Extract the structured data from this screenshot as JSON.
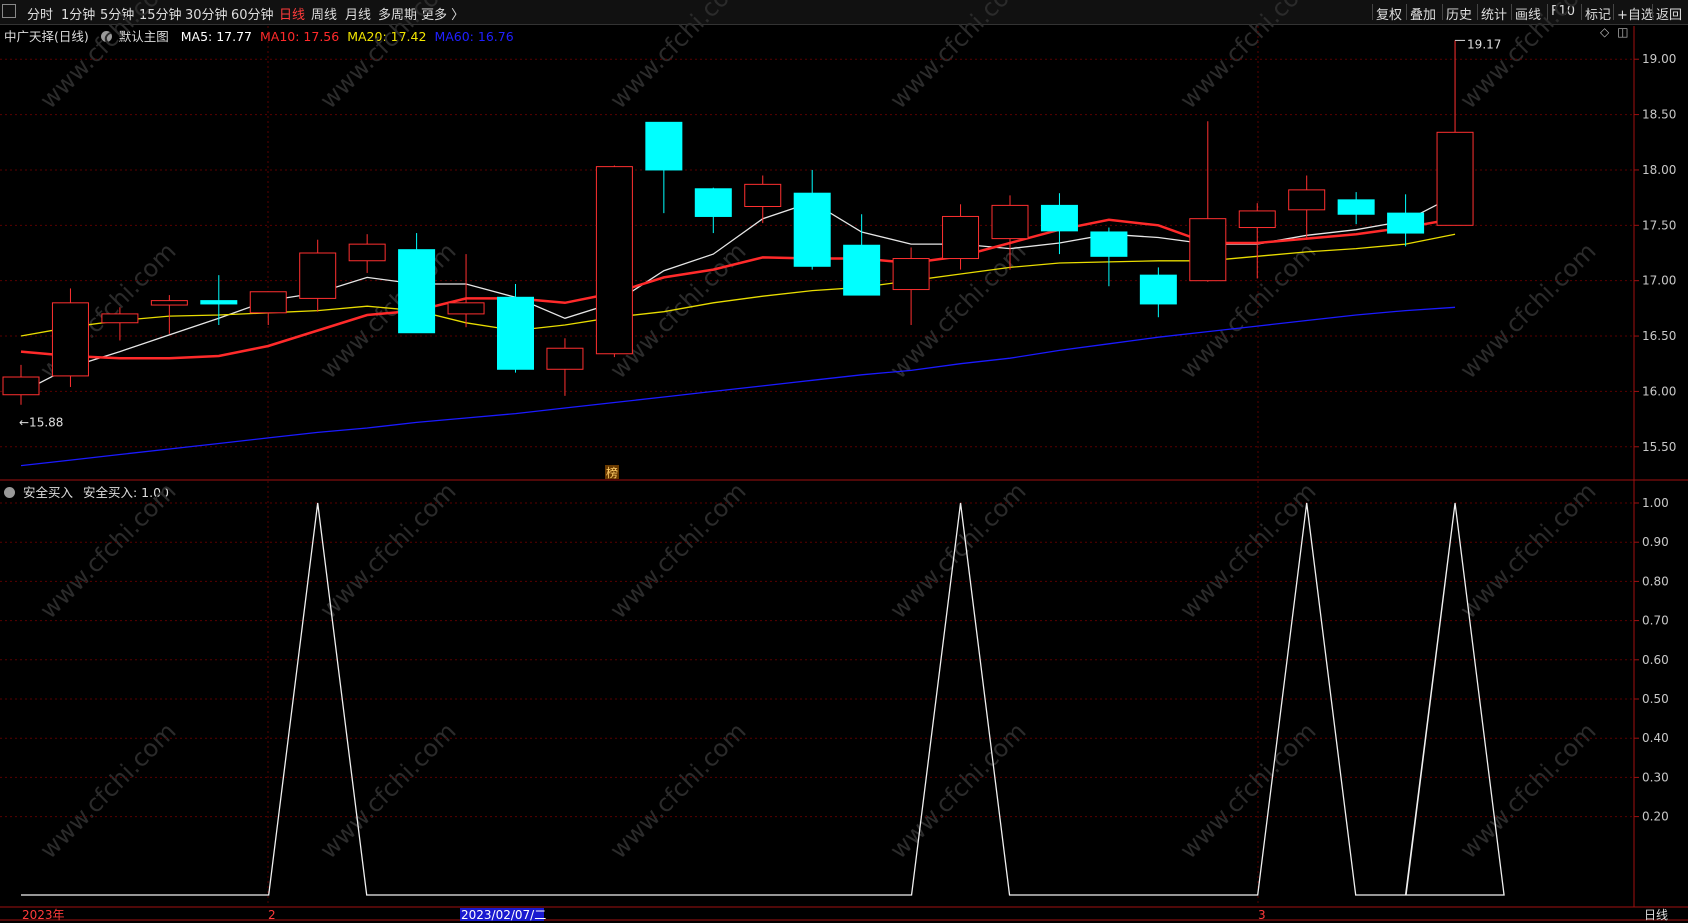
{
  "toolbar": {
    "periods": [
      "分时",
      "1分钟",
      "5分钟",
      "15分钟",
      "30分钟",
      "60分钟",
      "日线",
      "周线",
      "月线",
      "多周期",
      "更多 〉"
    ],
    "active_period": "日线",
    "tools": [
      "复权",
      "叠加",
      "历史",
      "统计",
      "画线",
      "F10",
      "标记",
      "+自选",
      "返回"
    ]
  },
  "main_panel": {
    "stock": "中广天择(日线)",
    "template": "默认主图",
    "ma": [
      {
        "label": "MA5: 17.77",
        "color": "#ffffff"
      },
      {
        "label": "MA10: 17.56",
        "color": "#ff2a2a"
      },
      {
        "label": "MA20: 17.42",
        "color": "#f2e600"
      },
      {
        "label": "MA60: 16.76",
        "color": "#2020ff"
      }
    ],
    "high_marker": "19.17",
    "low_marker": "15.88",
    "event_tag": "榜"
  },
  "sub_panel": {
    "indicator": "安全买入",
    "value_label": "安全买入: 1.00"
  },
  "x_axis": {
    "labels": [
      "2023年",
      "2",
      "2023/02/07/二",
      "3"
    ],
    "period_label": "日线"
  },
  "colors": {
    "up": "#ff3030",
    "down": "#00ffff",
    "grid": "#5a0000",
    "axis": "#a01010",
    "watermark": "#2b2b2b"
  },
  "watermark": "www.cfchi.com",
  "chart_data": [
    {
      "type": "candlestick",
      "title": "中广天择(日线)",
      "ylim": [
        15.2,
        19.3
      ],
      "yticks": [
        15.5,
        16.0,
        16.5,
        17.0,
        17.5,
        18.0,
        18.5,
        19.0
      ],
      "candles": [
        {
          "o": 15.97,
          "h": 16.24,
          "l": 15.88,
          "c": 16.13
        },
        {
          "o": 16.14,
          "h": 16.93,
          "l": 16.04,
          "c": 16.8
        },
        {
          "o": 16.62,
          "h": 16.76,
          "l": 16.46,
          "c": 16.7
        },
        {
          "o": 16.78,
          "h": 16.87,
          "l": 16.52,
          "c": 16.82
        },
        {
          "o": 16.82,
          "h": 17.05,
          "l": 16.6,
          "c": 16.79
        },
        {
          "o": 16.71,
          "h": 16.9,
          "l": 16.6,
          "c": 16.9
        },
        {
          "o": 16.84,
          "h": 17.37,
          "l": 16.72,
          "c": 17.25
        },
        {
          "o": 17.18,
          "h": 17.42,
          "l": 17.07,
          "c": 17.33
        },
        {
          "o": 17.28,
          "h": 17.43,
          "l": 16.57,
          "c": 16.53
        },
        {
          "o": 16.7,
          "h": 17.24,
          "l": 16.58,
          "c": 16.8
        },
        {
          "o": 16.85,
          "h": 16.97,
          "l": 16.17,
          "c": 16.2
        },
        {
          "o": 16.2,
          "h": 16.48,
          "l": 15.96,
          "c": 16.39
        },
        {
          "o": 16.34,
          "h": 18.04,
          "l": 16.31,
          "c": 18.03
        },
        {
          "o": 18.43,
          "h": 18.43,
          "l": 17.61,
          "c": 18.0
        },
        {
          "o": 17.83,
          "h": 17.84,
          "l": 17.43,
          "c": 17.58
        },
        {
          "o": 17.67,
          "h": 17.95,
          "l": 17.52,
          "c": 17.87
        },
        {
          "o": 17.79,
          "h": 18.0,
          "l": 17.1,
          "c": 17.13
        },
        {
          "o": 17.32,
          "h": 17.6,
          "l": 16.87,
          "c": 16.87
        },
        {
          "o": 16.92,
          "h": 17.3,
          "l": 16.6,
          "c": 17.2
        },
        {
          "o": 17.2,
          "h": 17.69,
          "l": 17.1,
          "c": 17.58
        },
        {
          "o": 17.38,
          "h": 17.77,
          "l": 17.1,
          "c": 17.68
        },
        {
          "o": 17.68,
          "h": 17.79,
          "l": 17.24,
          "c": 17.45
        },
        {
          "o": 17.44,
          "h": 17.48,
          "l": 16.95,
          "c": 17.22
        },
        {
          "o": 17.05,
          "h": 17.12,
          "l": 16.67,
          "c": 16.79
        },
        {
          "o": 17.0,
          "h": 18.44,
          "l": 16.99,
          "c": 17.56
        },
        {
          "o": 17.48,
          "h": 17.7,
          "l": 17.02,
          "c": 17.63
        },
        {
          "o": 17.64,
          "h": 17.95,
          "l": 17.37,
          "c": 17.82
        },
        {
          "o": 17.73,
          "h": 17.8,
          "l": 17.51,
          "c": 17.6
        },
        {
          "o": 17.61,
          "h": 17.78,
          "l": 17.31,
          "c": 17.43
        },
        {
          "o": 17.5,
          "h": 19.17,
          "l": 17.5,
          "c": 18.34
        }
      ],
      "series": [
        {
          "name": "MA5",
          "values": [
            15.99,
            16.22,
            16.36,
            16.51,
            16.66,
            16.82,
            16.89,
            17.03,
            16.97,
            16.97,
            16.85,
            16.66,
            16.8,
            17.09,
            17.24,
            17.56,
            17.71,
            17.44,
            17.33,
            17.33,
            17.29,
            17.34,
            17.42,
            17.39,
            17.33,
            17.33,
            17.41,
            17.46,
            17.54,
            17.77
          ]
        },
        {
          "name": "MA10",
          "values": [
            16.36,
            16.32,
            16.3,
            16.3,
            16.32,
            16.41,
            16.55,
            16.69,
            16.73,
            16.84,
            16.84,
            16.8,
            16.89,
            17.03,
            17.1,
            17.21,
            17.2,
            17.2,
            17.16,
            17.22,
            17.34,
            17.46,
            17.55,
            17.5,
            17.34,
            17.34,
            17.38,
            17.42,
            17.48,
            17.56
          ]
        },
        {
          "name": "MA20",
          "values": [
            16.5,
            16.58,
            16.64,
            16.68,
            16.69,
            16.71,
            16.73,
            16.77,
            16.73,
            16.62,
            16.55,
            16.6,
            16.67,
            16.72,
            16.8,
            16.86,
            16.91,
            16.94,
            17.0,
            17.06,
            17.12,
            17.16,
            17.17,
            17.18,
            17.18,
            17.22,
            17.26,
            17.29,
            17.33,
            17.42
          ]
        },
        {
          "name": "MA60",
          "values": [
            15.33,
            15.38,
            15.43,
            15.48,
            15.53,
            15.58,
            15.63,
            15.67,
            15.72,
            15.76,
            15.8,
            15.85,
            15.9,
            15.95,
            16.0,
            16.05,
            16.1,
            16.15,
            16.19,
            16.25,
            16.3,
            16.37,
            16.43,
            16.49,
            16.54,
            16.59,
            16.64,
            16.69,
            16.73,
            16.76
          ]
        }
      ]
    },
    {
      "type": "line",
      "title": "安全买入",
      "ylim": [
        0,
        1.05
      ],
      "yticks": [
        0.2,
        0.3,
        0.4,
        0.5,
        0.6,
        0.7,
        0.8,
        0.9,
        1.0
      ],
      "series": [
        {
          "name": "安全买入",
          "values": [
            0,
            0,
            0,
            0,
            0,
            0,
            1,
            0,
            0,
            0,
            0,
            0,
            0,
            0,
            0,
            0,
            0,
            0,
            0,
            1,
            0,
            0,
            0,
            0,
            0,
            0,
            1,
            0,
            0,
            1
          ]
        }
      ]
    }
  ]
}
